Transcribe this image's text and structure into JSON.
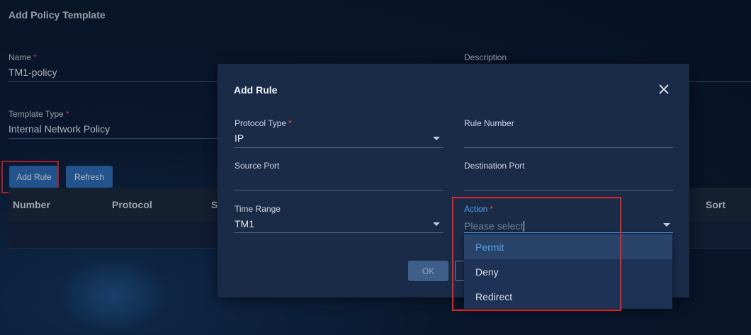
{
  "page": {
    "title": "Add Policy Template"
  },
  "form": {
    "name_label": "Name",
    "name_value": "TM1-policy",
    "description_label": "Description",
    "template_type_label": "Template Type",
    "template_type_value": "Internal Network Policy",
    "required_mark": "*"
  },
  "toolbar": {
    "add_rule_label": "Add Rule",
    "refresh_label": "Refresh"
  },
  "table": {
    "columns": [
      "Number",
      "Protocol",
      "S",
      "Sort"
    ]
  },
  "modal": {
    "title": "Add Rule",
    "protocol_type_label": "Protocol Type",
    "protocol_type_value": "IP",
    "rule_number_label": "Rule Number",
    "source_port_label": "Source Port",
    "destination_port_label": "Destination Port",
    "time_range_label": "Time Range",
    "time_range_value": "TM1",
    "action_label": "Action",
    "action_placeholder": "Please select",
    "ok_label": "OK"
  },
  "action_options": [
    "Permit",
    "Deny",
    "Redirect"
  ],
  "colors": {
    "accent": "#4ea0f2",
    "button_blue": "#2e6bb3",
    "highlight_red": "#e0262b",
    "required": "#e84a4a"
  }
}
